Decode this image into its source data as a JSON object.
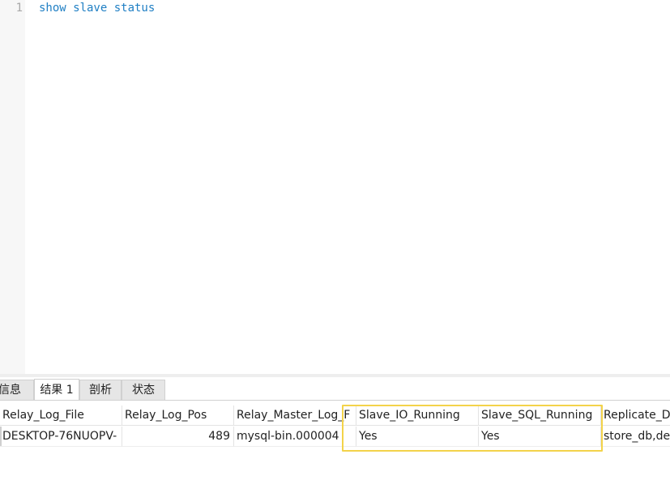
{
  "editor": {
    "line_number": "1",
    "sql": "show slave status"
  },
  "tabs": [
    {
      "label": "信息",
      "active": false
    },
    {
      "label": "结果 1",
      "active": true
    },
    {
      "label": "剖析",
      "active": false
    },
    {
      "label": "状态",
      "active": false
    }
  ],
  "grid": {
    "columns": [
      "Relay_Log_File",
      "Relay_Log_Pos",
      "Relay_Master_Log_F",
      "Slave_IO_Running",
      "Slave_SQL_Running",
      "Replicate_D"
    ],
    "rows": [
      [
        "DESKTOP-76NUOPV-",
        "489",
        "mysql-bin.000004",
        "Yes",
        "Yes",
        "store_db,de"
      ]
    ]
  },
  "colors": {
    "keyword": "#1f7fc4",
    "highlight": "#f3d34a"
  }
}
